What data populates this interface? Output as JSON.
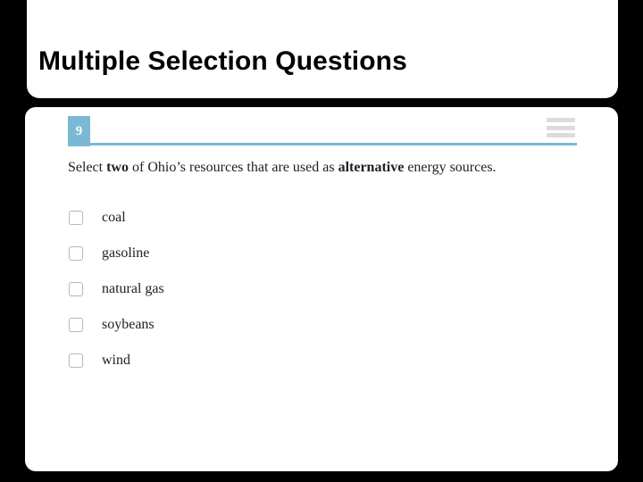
{
  "slide": {
    "title": "Multiple Selection Questions",
    "background_color": "#000000",
    "card_color": "#ffffff"
  },
  "question_card": {
    "number": "9",
    "accent_color": "#7ab8d4",
    "menu_icon": "hamburger-menu-icon",
    "prompt": {
      "part1": "Select ",
      "bold1": "two",
      "part2": " of Ohio’s resources that are used as ",
      "bold2": "alternative",
      "part3": " energy sources."
    },
    "options": [
      {
        "label": "coal",
        "checked": false
      },
      {
        "label": "gasoline",
        "checked": false
      },
      {
        "label": "natural gas",
        "checked": false
      },
      {
        "label": "soybeans",
        "checked": false
      },
      {
        "label": "wind",
        "checked": false
      }
    ]
  }
}
